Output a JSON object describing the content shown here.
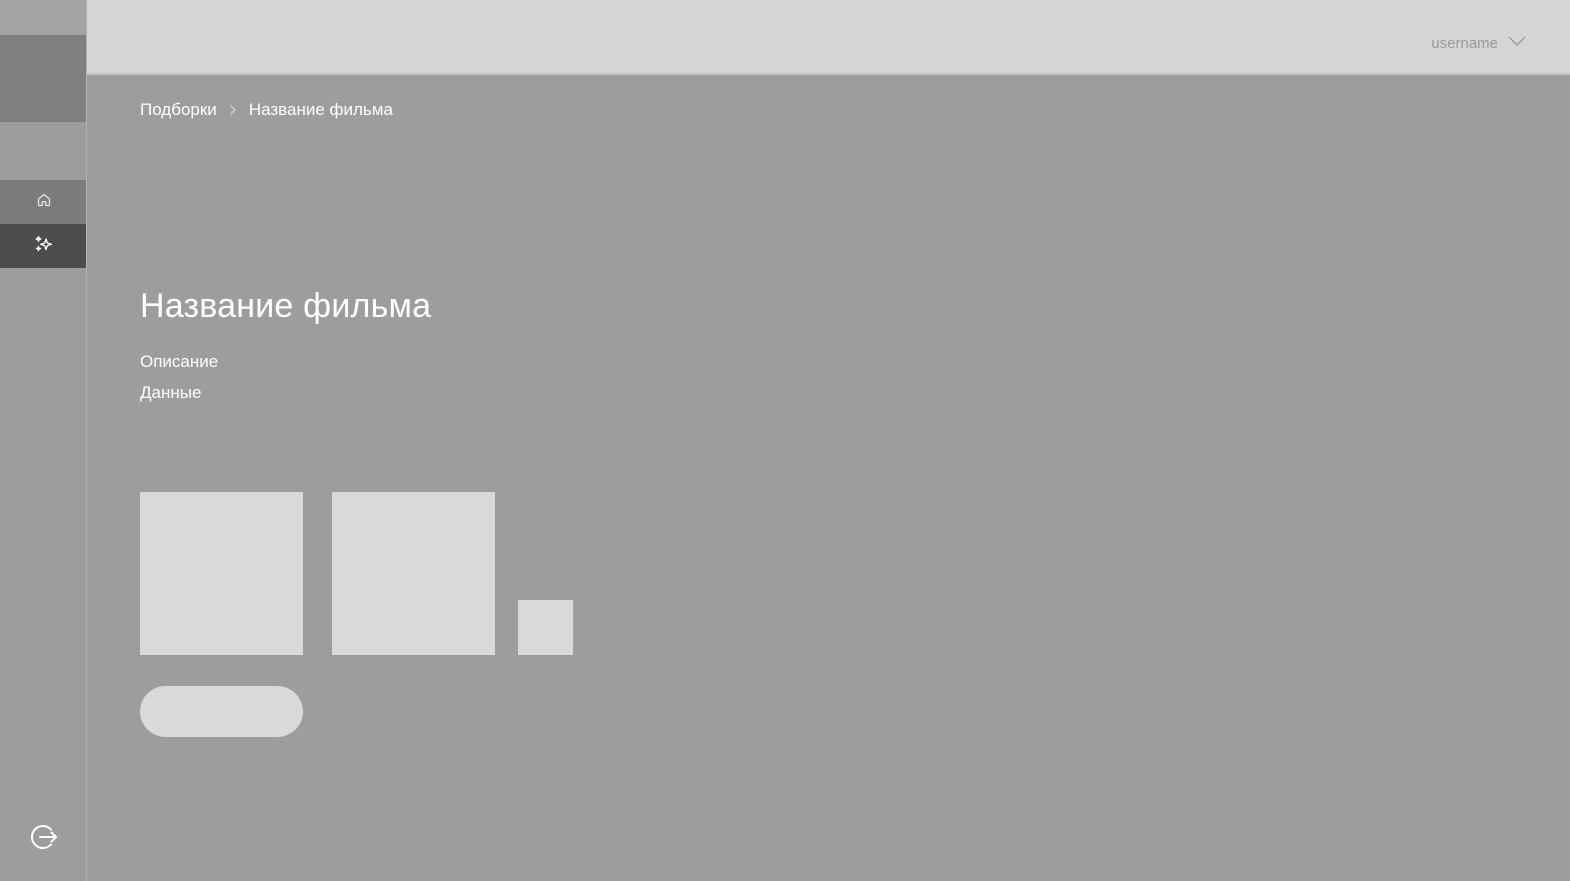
{
  "header": {
    "user_menu": {
      "username": "username",
      "icon": "chevron-down-icon"
    }
  },
  "sidebar": {
    "items": [
      {
        "name": "home",
        "icon": "home-icon"
      },
      {
        "name": "collections",
        "icon": "sparkles-icon",
        "active": true
      }
    ],
    "logout_icon": "logout-icon"
  },
  "breadcrumb": {
    "items": [
      "Подборки",
      "Название фильма"
    ],
    "separator_icon": "chevron-right-icon"
  },
  "main": {
    "title": "Название фильма",
    "description_label": "Описание",
    "data_label": "Данные",
    "action_button_label": ""
  },
  "colors": {
    "background": "#9d9d9d",
    "header": "#d5d5d5",
    "placeholder": "#d9d9d9",
    "nav_active": "#4d4d4d",
    "nav_home": "#7c7c7c",
    "text": "#ffffff"
  }
}
